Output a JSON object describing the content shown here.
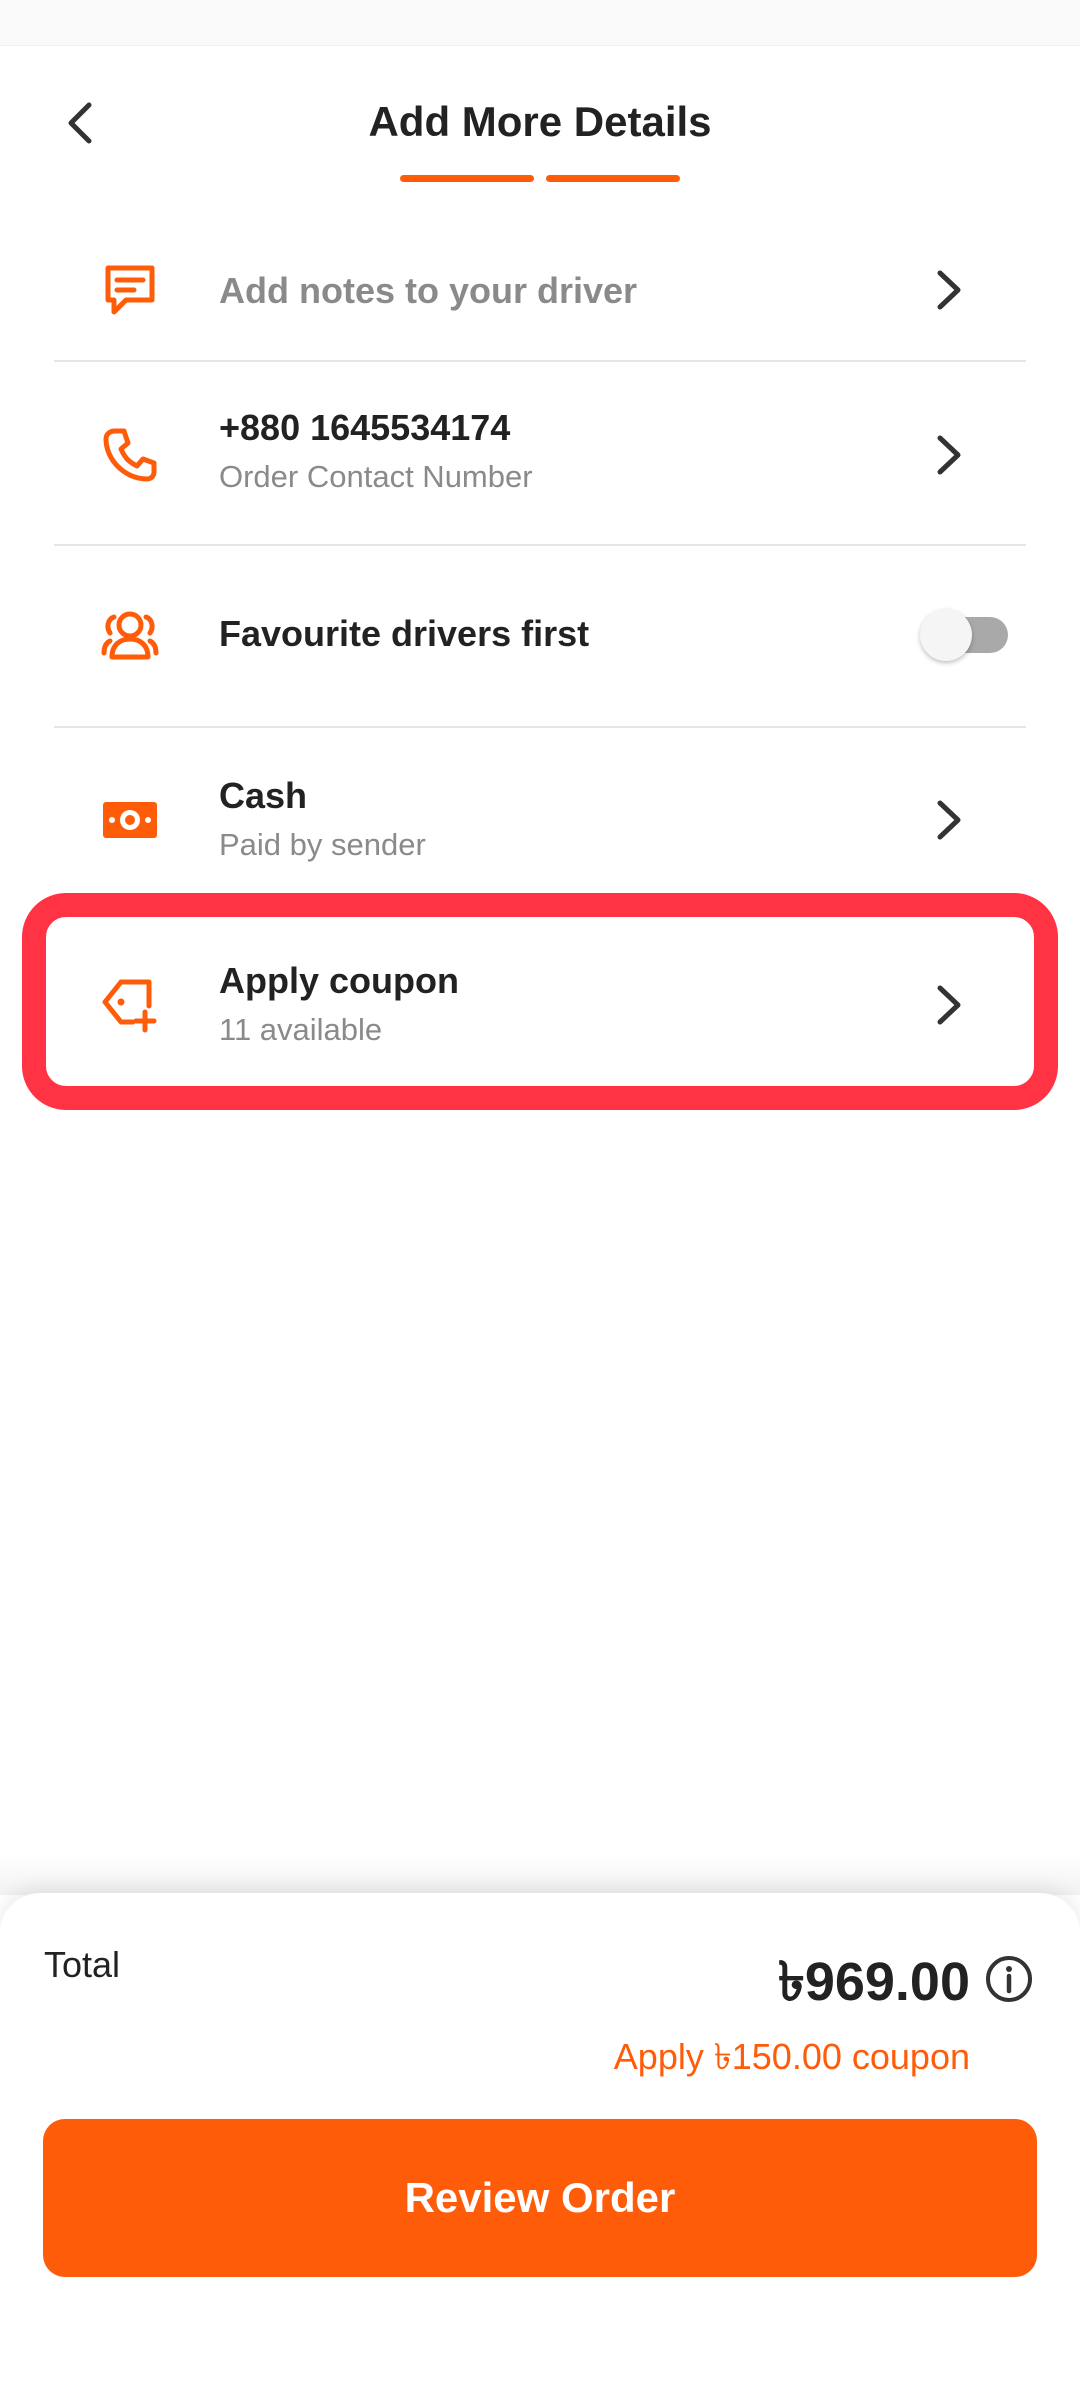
{
  "header": {
    "title": "Add More Details"
  },
  "rows": {
    "notes": {
      "title": "Add notes to your driver"
    },
    "contact": {
      "title": "+880 1645534174",
      "subtitle": "Order Contact Number"
    },
    "favourite": {
      "title": "Favourite drivers first",
      "enabled": false
    },
    "payment": {
      "title": "Cash",
      "subtitle": "Paid by sender"
    },
    "coupon": {
      "title": "Apply coupon",
      "subtitle": "11 available"
    }
  },
  "summary": {
    "total_label": "Total",
    "total_amount": "৳969.00",
    "coupon_hint": "Apply ৳150.00 coupon"
  },
  "actions": {
    "review_label": "Review Order"
  },
  "colors": {
    "accent": "#ff5c0a",
    "highlight": "#ff3344",
    "text": "#222222",
    "muted": "#8a8a8a"
  },
  "icons": {
    "back": "chevron-left-icon",
    "notes": "message-icon",
    "contact": "phone-icon",
    "favourite": "users-icon",
    "payment": "cash-icon",
    "coupon": "coupon-tag-icon",
    "chevron": "chevron-right-icon",
    "info": "info-icon"
  }
}
